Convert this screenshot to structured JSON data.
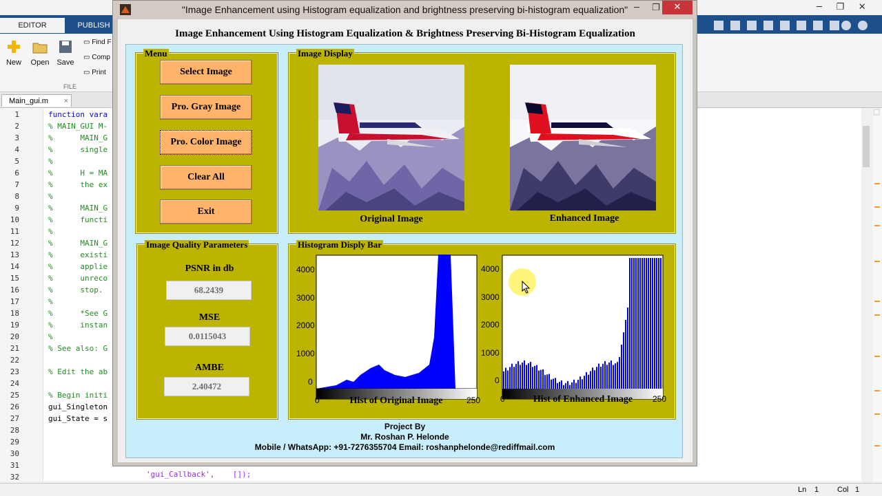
{
  "matlab": {
    "tabs": [
      "EDITOR",
      "PUBLISH"
    ],
    "ribbon": {
      "new": "New",
      "open": "Open",
      "save": "Save",
      "find": "Find F",
      "compare": "Comp",
      "print": "Print",
      "section": "FILE"
    },
    "file_tab": "Main_gui.m",
    "code_lines": [
      {
        "n": "1",
        "text": "function vara",
        "cls": "c-b"
      },
      {
        "n": "2",
        "text": "% MAIN_GUI M-",
        "cls": "c-g"
      },
      {
        "n": "3",
        "text": "%      MAIN_G",
        "cls": "c-g"
      },
      {
        "n": "4",
        "text": "%      single",
        "cls": "c-g"
      },
      {
        "n": "5",
        "text": "%",
        "cls": "c-g"
      },
      {
        "n": "6",
        "text": "%      H = MA",
        "cls": "c-g"
      },
      {
        "n": "7",
        "text": "%      the ex",
        "cls": "c-g"
      },
      {
        "n": "8",
        "text": "%",
        "cls": "c-g"
      },
      {
        "n": "9",
        "text": "%      MAIN_G",
        "cls": "c-g"
      },
      {
        "n": "10",
        "text": "%      functi",
        "cls": "c-g"
      },
      {
        "n": "11",
        "text": "%",
        "cls": "c-g"
      },
      {
        "n": "12",
        "text": "%      MAIN_G",
        "cls": "c-g"
      },
      {
        "n": "13",
        "text": "%      existi",
        "cls": "c-g"
      },
      {
        "n": "14",
        "text": "%      applie",
        "cls": "c-g"
      },
      {
        "n": "15",
        "text": "%      unreco",
        "cls": "c-g"
      },
      {
        "n": "16",
        "text": "%      stop.",
        "cls": "c-g"
      },
      {
        "n": "17",
        "text": "%",
        "cls": "c-g"
      },
      {
        "n": "18",
        "text": "%      *See G",
        "cls": "c-g"
      },
      {
        "n": "19",
        "text": "%      instan",
        "cls": "c-g"
      },
      {
        "n": "20",
        "text": "%",
        "cls": "c-g"
      },
      {
        "n": "21",
        "text": "% See also: G",
        "cls": "c-g"
      },
      {
        "n": "22",
        "text": "",
        "cls": "c-k"
      },
      {
        "n": "23",
        "text": "% Edit the ab",
        "cls": "c-g"
      },
      {
        "n": "24",
        "text": "",
        "cls": "c-k"
      },
      {
        "n": "25",
        "text": "% Begin initi",
        "cls": "c-g"
      },
      {
        "n": "26",
        "text": "gui_Singleton",
        "cls": "c-k"
      },
      {
        "n": "27",
        "text": "gui_State = s",
        "cls": "c-k"
      },
      {
        "n": "28",
        "text": "",
        "cls": "c-k"
      },
      {
        "n": "29",
        "text": "",
        "cls": "c-k"
      },
      {
        "n": "30",
        "text": "",
        "cls": "c-k"
      },
      {
        "n": "31",
        "text": "",
        "cls": "c-k"
      },
      {
        "n": "32",
        "text": "",
        "cls": "c-k"
      }
    ],
    "bottom_code": "'gui_Callback',    []);",
    "status": {
      "ln_label": "Ln",
      "ln": "1",
      "col_label": "Col",
      "col": "1"
    }
  },
  "gui": {
    "title": "\"Image Enhancement using Histogram equalization and brightness preserving bi-histogram equalization\"",
    "heading": "Image Enhancement Using Histogram Equalization & Brightness Preserving Bi-Histogram Equalization",
    "menu": {
      "title": "Menu",
      "buttons": [
        "Select Image",
        "Pro. Gray Image",
        "Pro. Color Image",
        "Clear All",
        "Exit"
      ]
    },
    "image_display": {
      "title": "Image Display",
      "original_caption": "Original Image",
      "enhanced_caption": "Enhanced Image"
    },
    "quality": {
      "title": "Image Quality Parameters",
      "psnr_label": "PSNR in db",
      "psnr_value": "68.2439",
      "mse_label": "MSE",
      "mse_value": "0.0115043",
      "ambe_label": "AMBE",
      "ambe_value": "2.40472"
    },
    "histogram": {
      "title": "Histogram Disply Bar",
      "left_caption": "Hist of Original Image",
      "right_caption": "Hist of Enhanced Image",
      "yticks": [
        "4000",
        "3000",
        "2000",
        "1000",
        "0"
      ],
      "xticks": [
        "0",
        "250"
      ]
    },
    "footer": {
      "line1": "Project By",
      "line2": "Mr. Roshan P. Helonde",
      "line3": "Mobile / WhatsApp: +91-7276355704      Email: roshanphelonde@rediffmail.com"
    },
    "colors": {
      "panel": "#bcb400",
      "button": "#ffb36b",
      "background": "#c8eefb",
      "hist_bar": "#0000ff"
    }
  }
}
